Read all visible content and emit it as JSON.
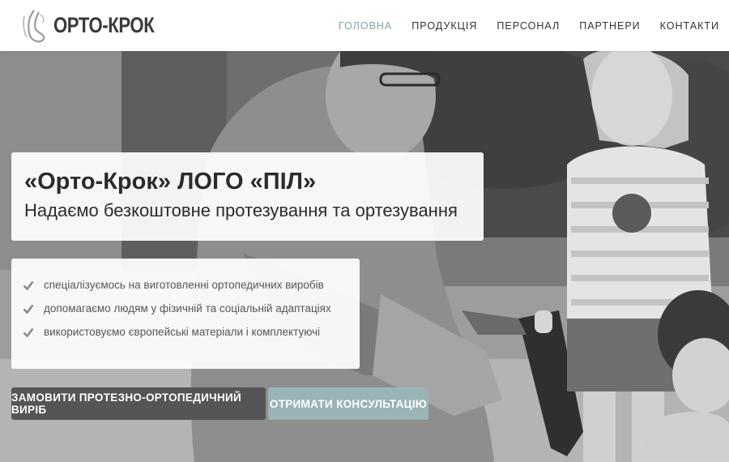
{
  "header": {
    "logo_text": "ОРТО-КРОК",
    "nav": [
      {
        "label": "ГОЛОВНА",
        "active": true
      },
      {
        "label": "ПРОДУКЦІЯ",
        "active": false
      },
      {
        "label": "ПЕРСОНАЛ",
        "active": false
      },
      {
        "label": "ПАРТНЕРИ",
        "active": false
      },
      {
        "label": "КОНТАКТИ",
        "active": false
      }
    ]
  },
  "hero": {
    "title": "«Орто-Крок» ЛОГО «ПІЛ»",
    "subtitle": "Надаємо безкоштовне протезування та ортезування",
    "features": [
      "спеціалізуємось на виготовленні ортопедичних виробів",
      "допомагаємо людям у фізичній та соціальній адаптаціях",
      "використовуємо європейські матеріали і комплектуючі"
    ],
    "buttons": {
      "order": "ЗАМОВИТИ ПРОТЕЗНО-ОРТОПЕДИЧНИЙ ВИРІБ",
      "consult": "ОТРИМАТИ КОНСУЛЬТАЦІЮ"
    }
  },
  "colors": {
    "accent": "#7fa5a8",
    "button_dark": "#555555",
    "button_light": "#9ab4b6",
    "check": "#8a8a8a"
  },
  "icons": {
    "logo": "foot-logo-icon",
    "bullet": "check-icon"
  }
}
